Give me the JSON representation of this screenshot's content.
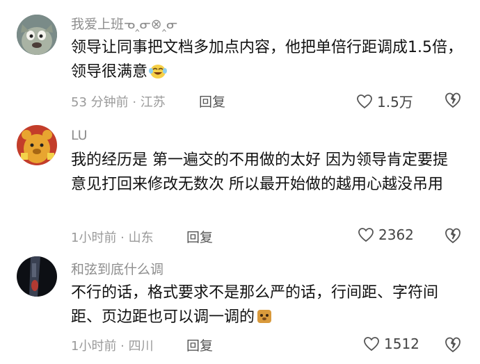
{
  "comments": [
    {
      "username": "我爱上班ᓀ‸ᓂ⊗‸ᓂ",
      "content": "领导让同事把文档多加点内容，他把单倍行距调成1.5倍，领导很满意",
      "time_location": "53 分钟前 · 江苏",
      "reply_label": "回复",
      "likes": "1.5万"
    },
    {
      "username": "LU",
      "content": "我的经历是 第一遍交的不用做的太好 因为领导肯定要提意见打回来修改无数次 所以最开始做的越用心越没吊用",
      "time_location": "1小时前 · 山东",
      "reply_label": "回复",
      "likes": "2362"
    },
    {
      "username": "和弦到底什么调",
      "content": "不行的话，格式要求不是那么严的话，行间距、字符间距、页边距也可以调一调的",
      "time_location": "1小时前 · 四川",
      "reply_label": "回复",
      "likes": "1512"
    }
  ]
}
